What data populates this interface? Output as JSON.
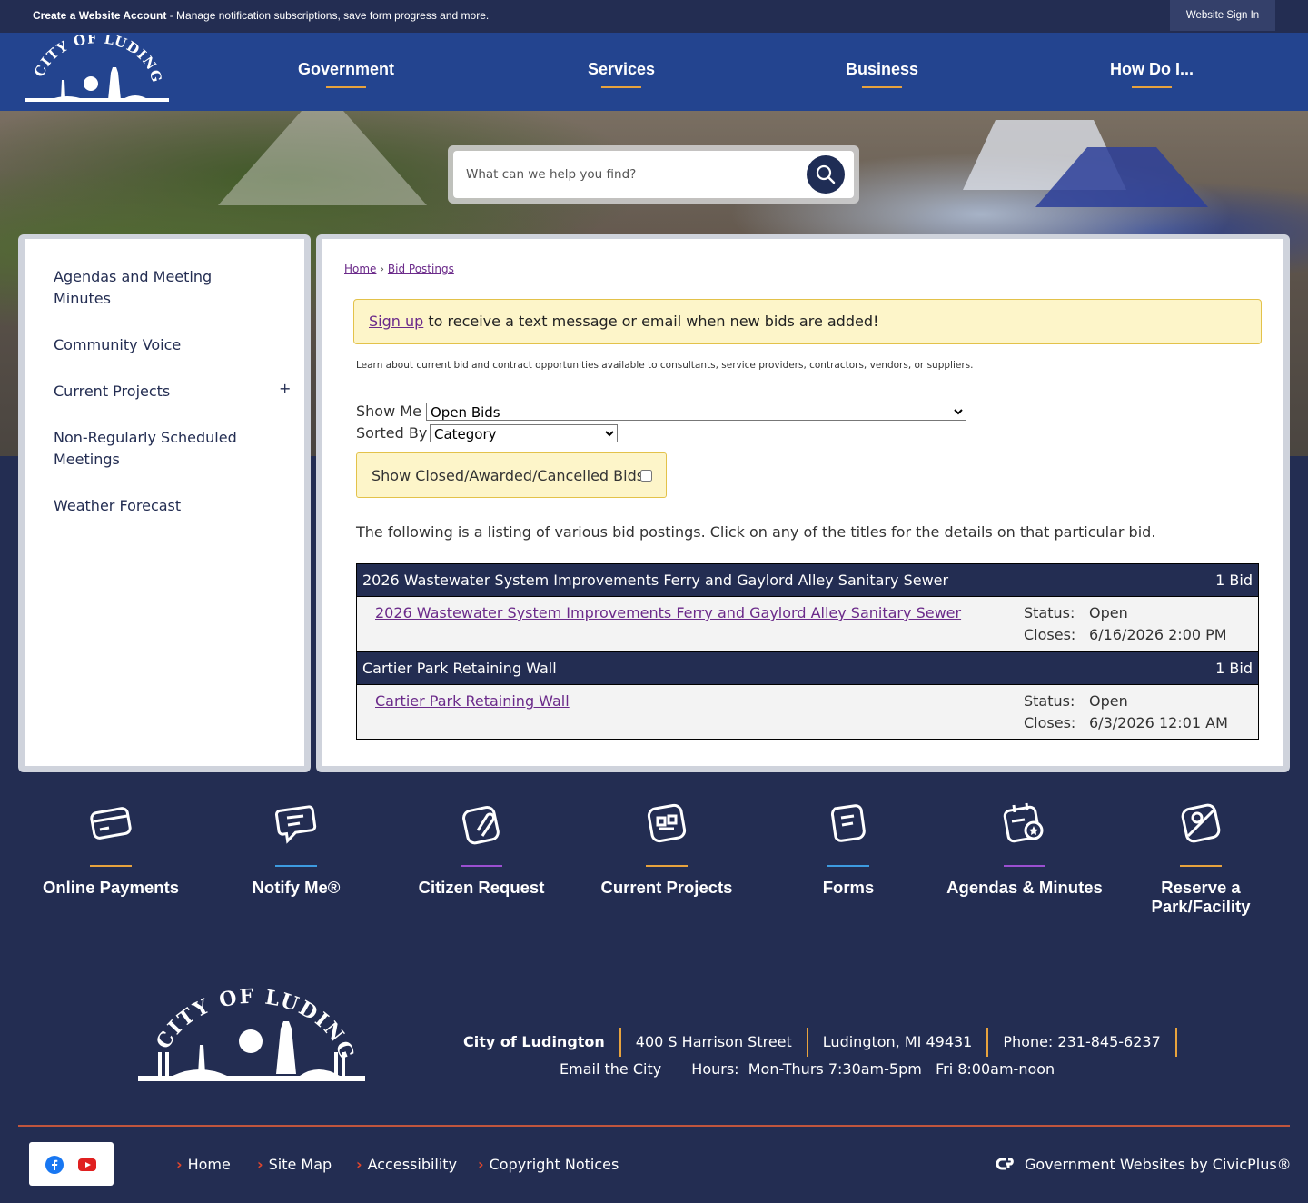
{
  "topbar": {
    "create_bold": "Create a Website Account",
    "create_rest": " - Manage notification subscriptions, save form progress and more.",
    "signin": "Website Sign In"
  },
  "header": {
    "logo_text": "CITY OF LUDINGTON",
    "nav": [
      "Government",
      "Services",
      "Business",
      "How Do I..."
    ]
  },
  "search": {
    "placeholder": "What can we help you find?"
  },
  "sidebar": {
    "items": [
      {
        "label": "Agendas and Meeting Minutes"
      },
      {
        "label": "Community Voice"
      },
      {
        "label": "Current Projects",
        "expand": "+"
      },
      {
        "label": "Non-Regularly Scheduled Meetings"
      },
      {
        "label": "Weather Forecast"
      }
    ]
  },
  "main": {
    "breadcrumb": {
      "home": "Home",
      "sep": "›",
      "current": "Bid Postings"
    },
    "signup_link": "Sign up",
    "signup_text": " to receive a text message or email when new bids are added!",
    "learn": "Learn about current bid and contract opportunities available to consultants, service providers, contractors, vendors, or suppliers.",
    "show_me_label": "Show Me",
    "show_me_value": "Open Bids",
    "sorted_by_label": "Sorted By",
    "sorted_by_value": "Category",
    "closed_label": "Show Closed/Awarded/Cancelled Bids:",
    "listing_text": "The following is a listing of various bid postings. Click on any of the titles for the details on that particular bid.",
    "categories": [
      {
        "name": "2026 Wastewater System Improvements Ferry and Gaylord Alley Sanitary Sewer",
        "count": "1 Bid",
        "bid": {
          "title": "2026 Wastewater System Improvements Ferry and Gaylord Alley Sanitary Sewer",
          "status_label": "Status:",
          "status": "Open",
          "closes_label": "Closes:",
          "closes": "6/16/2026 2:00 PM"
        }
      },
      {
        "name": "Cartier Park Retaining Wall",
        "count": "1 Bid",
        "bid": {
          "title": "Cartier Park Retaining Wall",
          "status_label": "Status:",
          "status": "Open",
          "closes_label": "Closes:",
          "closes": "6/3/2026 12:01 AM"
        }
      }
    ]
  },
  "quick_links": [
    {
      "label": "Online Payments",
      "icon": "credit-card-icon",
      "color": "#e8a33d"
    },
    {
      "label": "Notify Me®",
      "icon": "chat-bubble-icon",
      "color": "#3d9be0"
    },
    {
      "label": "Citizen Request",
      "icon": "paperclip-icon",
      "color": "#9b4fd1"
    },
    {
      "label": "Current Projects",
      "icon": "projects-icon",
      "color": "#e8a33d"
    },
    {
      "label": "Forms",
      "icon": "forms-icon",
      "color": "#3d9be0"
    },
    {
      "label": "Agendas & Minutes",
      "icon": "calendar-icon",
      "color": "#9b4fd1"
    },
    {
      "label": "Reserve a Park/Facility",
      "label_line1": "Reserve a",
      "label_line2": "Park/Facility",
      "icon": "map-pin-icon",
      "color": "#e8a33d"
    }
  ],
  "footer": {
    "org": "City of Ludington",
    "address": "400 S Harrison Street",
    "city": "Ludington, MI 49431",
    "phone": "Phone: 231-845-6237",
    "email": "Email the City",
    "hours": "Hours:  Mon-Thurs 7:30am-5pm   Fri 8:00am-noon",
    "links": [
      "Home",
      "Site Map",
      "Accessibility",
      "Copyright Notices"
    ],
    "civic": "Government Websites by CivicPlus®"
  },
  "colors": {
    "navy": "#232d52",
    "header_blue": "#23448f",
    "accent": "#e8a33d",
    "link": "#6b2a8a"
  }
}
